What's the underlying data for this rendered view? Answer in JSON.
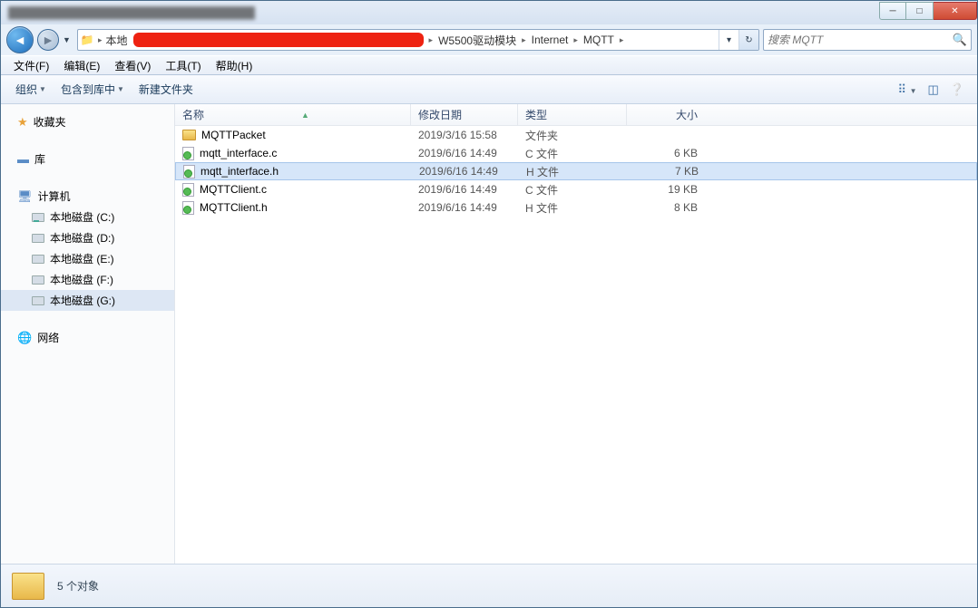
{
  "title_blur": "████████████████████████████████",
  "breadcrumb": {
    "seg0": "本地",
    "seg1": "W5500驱动模块",
    "seg2": "Internet",
    "seg3": "MQTT"
  },
  "search": {
    "placeholder": "搜索 MQTT"
  },
  "menu": {
    "file": "文件(F)",
    "edit": "编辑(E)",
    "view": "查看(V)",
    "tools": "工具(T)",
    "help": "帮助(H)"
  },
  "toolbar": {
    "organize": "组织",
    "include": "包含到库中",
    "newfolder": "新建文件夹"
  },
  "sidebar": {
    "favorites": "收藏夹",
    "libraries": "库",
    "computer": "计算机",
    "disks": [
      "本地磁盘 (C:)",
      "本地磁盘 (D:)",
      "本地磁盘 (E:)",
      "本地磁盘 (F:)",
      "本地磁盘 (G:)"
    ],
    "network": "网络"
  },
  "columns": {
    "name": "名称",
    "date": "修改日期",
    "type": "类型",
    "size": "大小"
  },
  "files": [
    {
      "name": "MQTTPacket",
      "date": "2019/3/16 15:58",
      "type": "文件夹",
      "size": "",
      "icon": "folder"
    },
    {
      "name": "mqtt_interface.c",
      "date": "2019/6/16 14:49",
      "type": "C 文件",
      "size": "6 KB",
      "icon": "c"
    },
    {
      "name": "mqtt_interface.h",
      "date": "2019/6/16 14:49",
      "type": "H 文件",
      "size": "7 KB",
      "icon": "h",
      "selected": true
    },
    {
      "name": "MQTTClient.c",
      "date": "2019/6/16 14:49",
      "type": "C 文件",
      "size": "19 KB",
      "icon": "c"
    },
    {
      "name": "MQTTClient.h",
      "date": "2019/6/16 14:49",
      "type": "H 文件",
      "size": "8 KB",
      "icon": "h"
    }
  ],
  "status": {
    "count": "5 个对象"
  }
}
